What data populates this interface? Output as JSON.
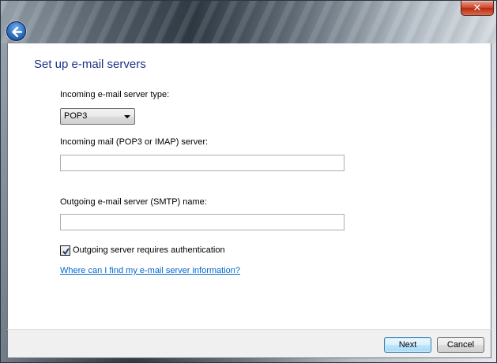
{
  "window": {
    "close_label": "✕"
  },
  "page": {
    "title": "Set up e-mail servers"
  },
  "form": {
    "incoming_type_label": "Incoming e-mail server type:",
    "incoming_type_value": "POP3",
    "incoming_server_label": "Incoming mail (POP3 or IMAP) server:",
    "incoming_server_value": "",
    "outgoing_server_label": "Outgoing e-mail server (SMTP) name:",
    "outgoing_server_value": "",
    "auth_checkbox_label": "Outgoing server requires authentication",
    "auth_checked": true,
    "help_link": "Where can I find my e-mail server information?"
  },
  "footer": {
    "next_label": "Next",
    "cancel_label": "Cancel"
  },
  "colors": {
    "title": "#1e3287",
    "link": "#0066cc",
    "close": "#c7381c"
  },
  "icons": [
    "back-arrow-icon",
    "close-icon",
    "checkmark-icon",
    "dropdown-arrow-icon"
  ]
}
